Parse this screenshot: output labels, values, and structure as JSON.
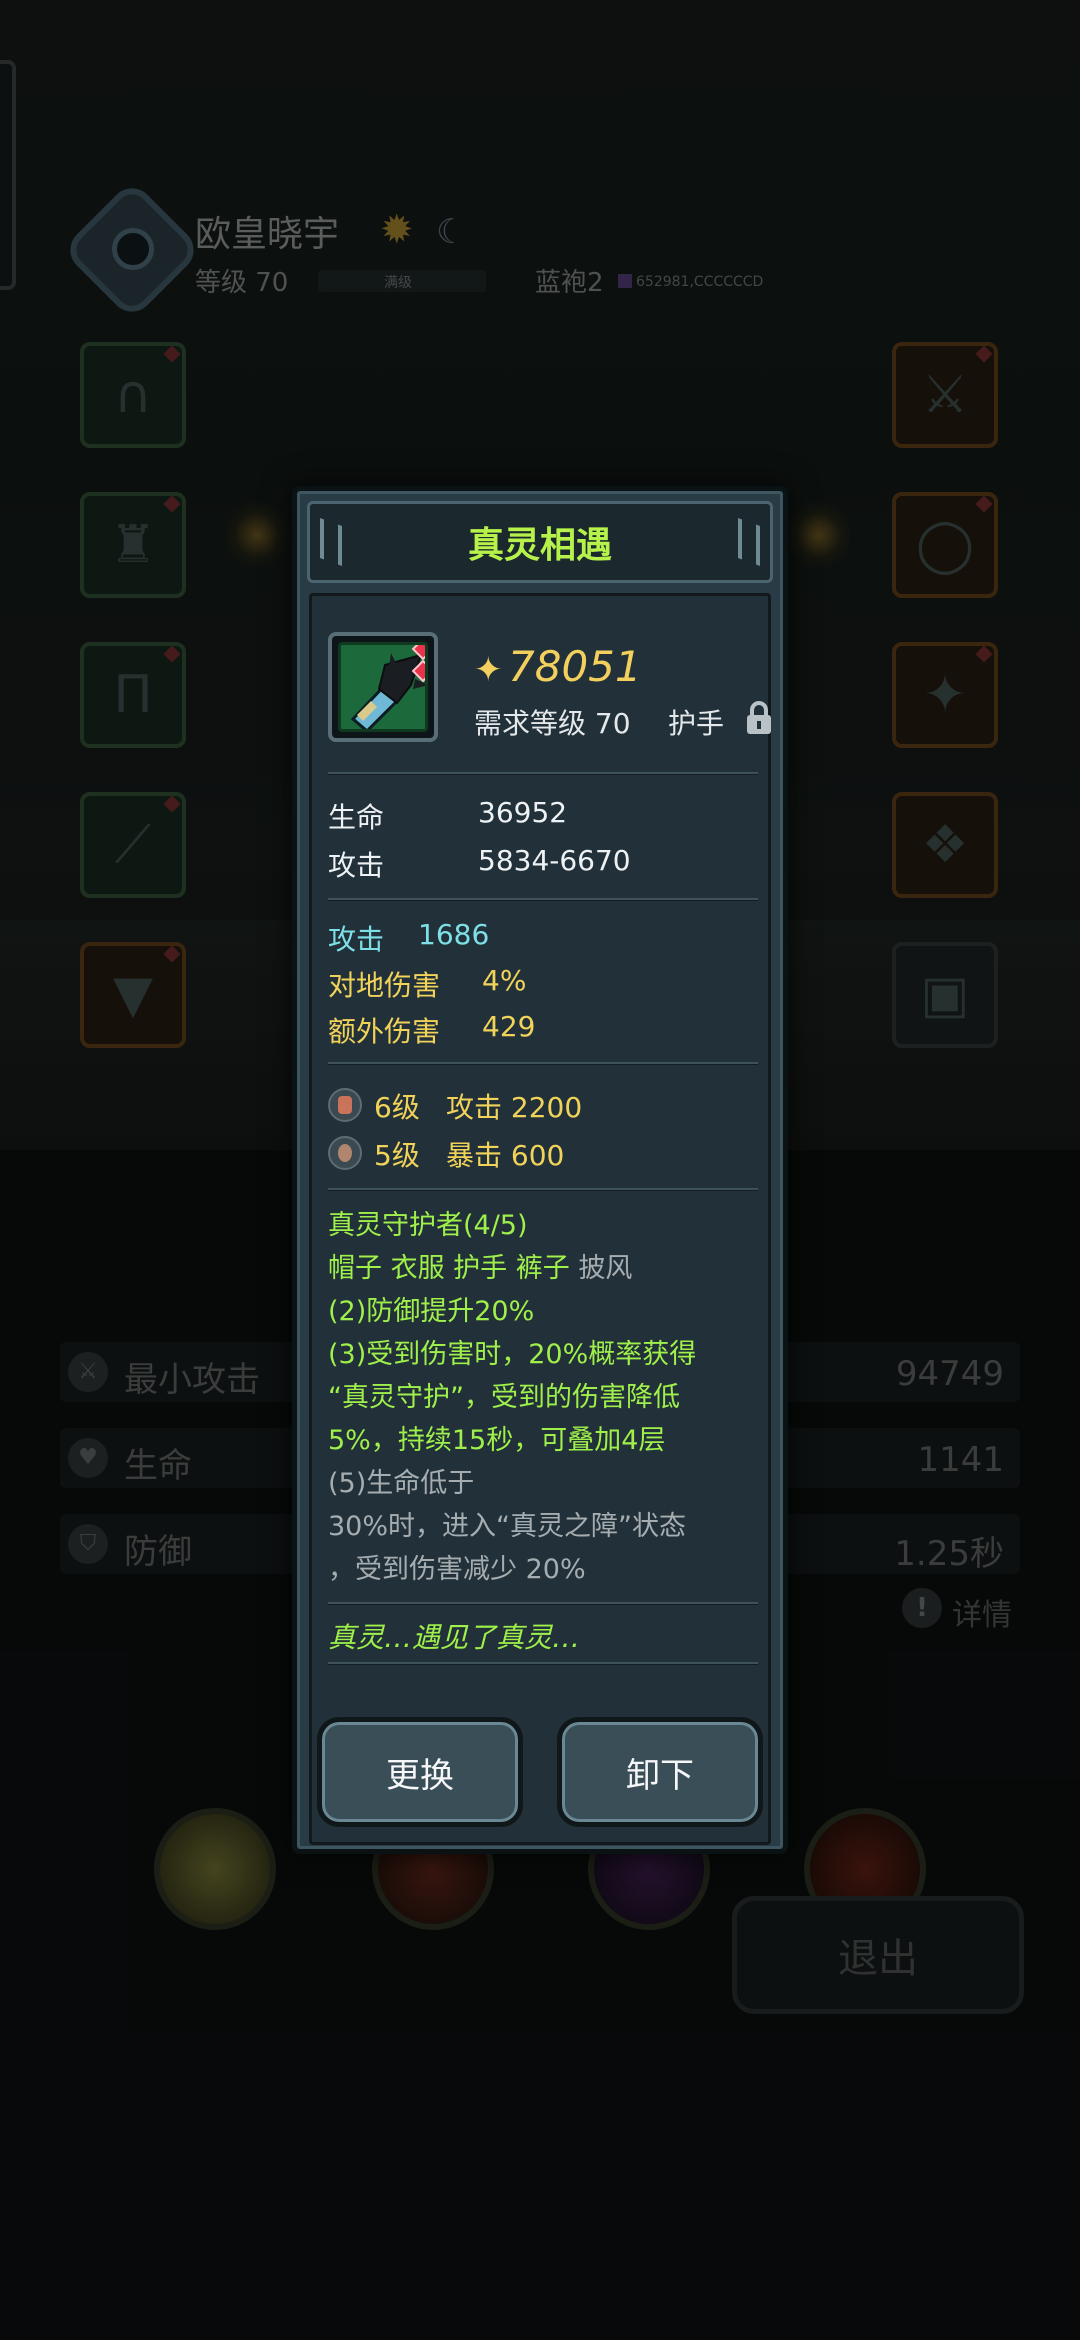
{
  "background": {
    "player_name": "欧皇晓宇",
    "level_label": "等级 70",
    "level_bar_text": "满级",
    "robe_label": "蓝袍2",
    "robe_code": "652981,CCCCCCD",
    "stats": [
      {
        "label": "最小攻击",
        "value": "94749",
        "icon": "sword-icon"
      },
      {
        "label": "生命",
        "value": "1141",
        "icon": "heart-icon"
      },
      {
        "label": "防御",
        "value": "1.25秒",
        "icon": "shield-icon"
      }
    ],
    "detail_label": "详情",
    "exit_label": "退出"
  },
  "modal": {
    "title": "真灵相遇",
    "power_icon": "power-icon",
    "power": "78051",
    "required_level": "需求等级 70",
    "slot_name": "护手",
    "base_stats": [
      {
        "label": "生命",
        "value": "36952"
      },
      {
        "label": "攻击",
        "value": "5834-6670"
      }
    ],
    "bonus_stats": [
      {
        "label": "攻击",
        "value": "1686",
        "color": "#7ee0e6"
      },
      {
        "label": "对地伤害",
        "value": "4%",
        "color": "#f1d35a"
      },
      {
        "label": "额外伤害",
        "value": "429",
        "color": "#f1d35a"
      }
    ],
    "gems": [
      {
        "level": "6级",
        "effect": "攻击 2200"
      },
      {
        "level": "5级",
        "effect": "暴击 600"
      }
    ],
    "set": {
      "name": "真灵守护者(4/5)",
      "pieces_active": "帽子 衣服 护手 裤子",
      "pieces_inactive": "披风",
      "bonus_2": "(2)防御提升20%",
      "bonus_3_line1": "(3)受到伤害时，20%概率获得",
      "bonus_3_line2": "“真灵守护”，受到的伤害降低",
      "bonus_3_line3": "5%，持续15秒，可叠加4层",
      "bonus_5_line1": "(5)生命低于",
      "bonus_5_line2": "30%时，进入“真灵之障”状态",
      "bonus_5_line3": "，受到伤害减少 20%"
    },
    "flavor": "真灵…遇见了真灵…",
    "replace_label": "更换",
    "unequip_label": "卸下"
  },
  "colors": {
    "title_green": "#b6f24a",
    "set_green": "#9ff04a",
    "gold": "#f1d35a",
    "cyan": "#7ee0e6",
    "panel": "#293b44"
  }
}
